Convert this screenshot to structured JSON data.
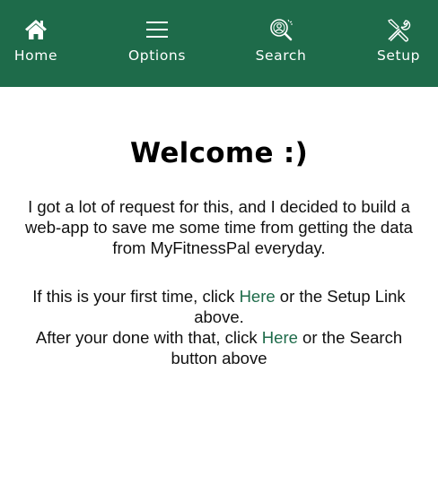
{
  "colors": {
    "nav_bg": "#1e6b4a",
    "link": "#1e6b4a"
  },
  "nav": {
    "items": [
      {
        "label": "Home",
        "icon": "home-icon"
      },
      {
        "label": "Options",
        "icon": "menu-icon"
      },
      {
        "label": "Search",
        "icon": "search-user-icon"
      },
      {
        "label": "Setup",
        "icon": "tools-icon"
      }
    ]
  },
  "main": {
    "title": "Welcome :)",
    "intro": "I got a lot of request for this, and I decided to build a web-app to save me some time from getting the data from MyFitnessPal everyday.",
    "line1_before": "If this is your first time, click ",
    "line1_link": "Here",
    "line1_after": " or the Setup Link above.",
    "line2_before": "After your done with that, click ",
    "line2_link": "Here",
    "line2_after": " or the Search button above"
  }
}
